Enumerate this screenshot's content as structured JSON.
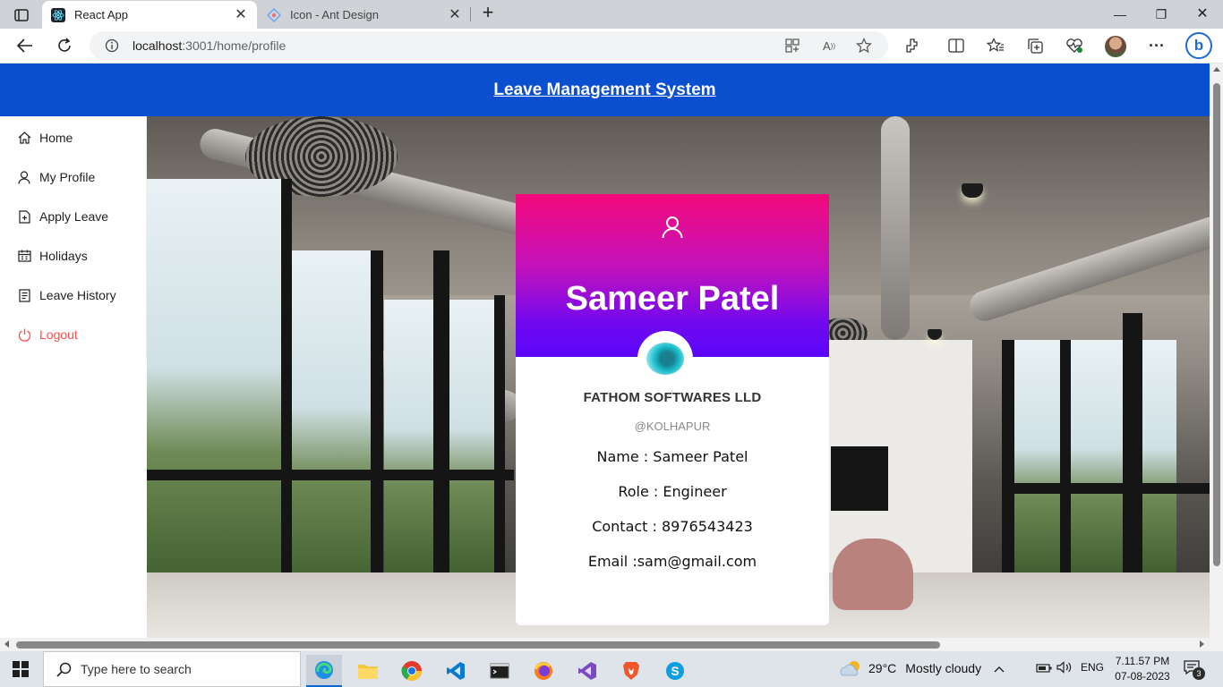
{
  "browser": {
    "tabs": [
      {
        "title": "React App",
        "active": true
      },
      {
        "title": "Icon - Ant Design",
        "active": false
      }
    ],
    "url_host": "localhost",
    "url_path": ":3001/home/profile"
  },
  "app": {
    "header_title": "Leave Management System",
    "menu": [
      {
        "label": "Home",
        "icon": "home-icon"
      },
      {
        "label": "My Profile",
        "icon": "user-icon"
      },
      {
        "label": "Apply Leave",
        "icon": "file-add-icon"
      },
      {
        "label": "Holidays",
        "icon": "calendar-icon"
      },
      {
        "label": "Leave History",
        "icon": "list-icon"
      },
      {
        "label": "Logout",
        "icon": "power-icon"
      }
    ]
  },
  "profile": {
    "name": "Sameer Patel",
    "company": "FATHOM SOFTWARES LLD",
    "location": "@KOLHAPUR",
    "fields": [
      "Name : Sameer Patel",
      "Role : Engineer",
      "Contact : 8976543423",
      "Email :sam@gmail.com"
    ]
  },
  "taskbar": {
    "search_placeholder": "Type here to search",
    "weather_temp": "29°C",
    "weather_desc": "Mostly cloudy",
    "language": "ENG",
    "time": "7.11.57 PM",
    "date": "07-08-2023",
    "notification_count": "3"
  },
  "colors": {
    "header_blue": "#0a4fcf",
    "logout_red": "#ff4d4f",
    "gradient_top": "#f4097b",
    "gradient_bottom": "#5a06fb"
  }
}
